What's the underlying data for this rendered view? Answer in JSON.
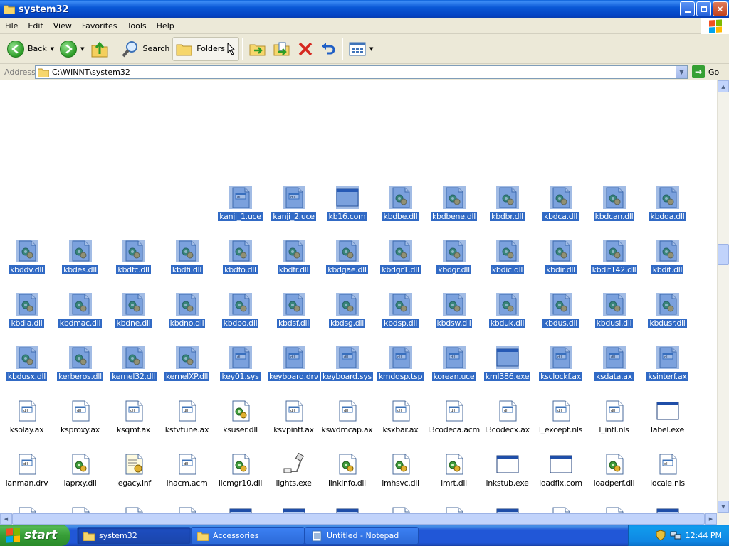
{
  "window": {
    "title": "system32"
  },
  "menu": {
    "items": [
      "File",
      "Edit",
      "View",
      "Favorites",
      "Tools",
      "Help"
    ]
  },
  "toolbar": {
    "back": "Back",
    "search": "Search",
    "folders": "Folders"
  },
  "address": {
    "label": "Address",
    "path": "C:\\WINNT\\system32",
    "go": "Go"
  },
  "files": [
    {
      "name": "kanji_1.uce",
      "type": "doc",
      "sel": true
    },
    {
      "name": "kanji_2.uce",
      "type": "doc",
      "sel": true
    },
    {
      "name": "kb16.com",
      "type": "exe",
      "sel": true
    },
    {
      "name": "kbdbe.dll",
      "type": "dll",
      "sel": true
    },
    {
      "name": "kbdbene.dll",
      "type": "dll",
      "sel": true
    },
    {
      "name": "kbdbr.dll",
      "type": "dll",
      "sel": true
    },
    {
      "name": "kbdca.dll",
      "type": "dll",
      "sel": true
    },
    {
      "name": "kbdcan.dll",
      "type": "dll",
      "sel": true
    },
    {
      "name": "kbdda.dll",
      "type": "dll",
      "sel": true
    },
    {
      "name": "kbddv.dll",
      "type": "dll",
      "sel": true
    },
    {
      "name": "kbdes.dll",
      "type": "dll",
      "sel": true
    },
    {
      "name": "kbdfc.dll",
      "type": "dll",
      "sel": true
    },
    {
      "name": "kbdfi.dll",
      "type": "dll",
      "sel": true
    },
    {
      "name": "kbdfo.dll",
      "type": "dll",
      "sel": true
    },
    {
      "name": "kbdfr.dll",
      "type": "dll",
      "sel": true
    },
    {
      "name": "kbdgae.dll",
      "type": "dll",
      "sel": true
    },
    {
      "name": "kbdgr1.dll",
      "type": "dll",
      "sel": true
    },
    {
      "name": "kbdgr.dll",
      "type": "dll",
      "sel": true
    },
    {
      "name": "kbdic.dll",
      "type": "dll",
      "sel": true
    },
    {
      "name": "kbdir.dll",
      "type": "dll",
      "sel": true
    },
    {
      "name": "kbdit142.dll",
      "type": "dll",
      "sel": true
    },
    {
      "name": "kbdit.dll",
      "type": "dll",
      "sel": true
    },
    {
      "name": "kbdla.dll",
      "type": "dll",
      "sel": true
    },
    {
      "name": "kbdmac.dll",
      "type": "dll",
      "sel": true
    },
    {
      "name": "kbdne.dll",
      "type": "dll",
      "sel": true
    },
    {
      "name": "kbdno.dll",
      "type": "dll",
      "sel": true
    },
    {
      "name": "kbdpo.dll",
      "type": "dll",
      "sel": true
    },
    {
      "name": "kbdsf.dll",
      "type": "dll",
      "sel": true
    },
    {
      "name": "kbdsg.dll",
      "type": "dll",
      "sel": true
    },
    {
      "name": "kbdsp.dll",
      "type": "dll",
      "sel": true
    },
    {
      "name": "kbdsw.dll",
      "type": "dll",
      "sel": true
    },
    {
      "name": "kbduk.dll",
      "type": "dll",
      "sel": true
    },
    {
      "name": "kbdus.dll",
      "type": "dll",
      "sel": true
    },
    {
      "name": "kbdusl.dll",
      "type": "dll",
      "sel": true
    },
    {
      "name": "kbdusr.dll",
      "type": "dll",
      "sel": true
    },
    {
      "name": "kbdusx.dll",
      "type": "dll",
      "sel": true
    },
    {
      "name": "kerberos.dll",
      "type": "dll",
      "sel": true
    },
    {
      "name": "kernel32.dll",
      "type": "dll",
      "sel": true
    },
    {
      "name": "kernelXP.dll",
      "type": "dll",
      "sel": true
    },
    {
      "name": "key01.sys",
      "type": "doc",
      "sel": true
    },
    {
      "name": "keyboard.drv",
      "type": "doc",
      "sel": true
    },
    {
      "name": "keyboard.sys",
      "type": "doc",
      "sel": true
    },
    {
      "name": "kmddsp.tsp",
      "type": "doc",
      "sel": true
    },
    {
      "name": "korean.uce",
      "type": "doc",
      "sel": true
    },
    {
      "name": "krnl386.exe",
      "type": "exe",
      "sel": true
    },
    {
      "name": "ksclockf.ax",
      "type": "doc",
      "sel": true
    },
    {
      "name": "ksdata.ax",
      "type": "doc",
      "sel": true
    },
    {
      "name": "ksinterf.ax",
      "type": "doc",
      "sel": true
    },
    {
      "name": "ksolay.ax",
      "type": "ax",
      "sel": false
    },
    {
      "name": "ksproxy.ax",
      "type": "ax",
      "sel": false
    },
    {
      "name": "ksqmf.ax",
      "type": "ax",
      "sel": false
    },
    {
      "name": "kstvtune.ax",
      "type": "ax",
      "sel": false
    },
    {
      "name": "ksuser.dll",
      "type": "dllw",
      "sel": false
    },
    {
      "name": "ksvpintf.ax",
      "type": "ax",
      "sel": false
    },
    {
      "name": "kswdmcap.ax",
      "type": "ax",
      "sel": false
    },
    {
      "name": "ksxbar.ax",
      "type": "ax",
      "sel": false
    },
    {
      "name": "l3codeca.acm",
      "type": "ax",
      "sel": false
    },
    {
      "name": "l3codecx.ax",
      "type": "ax",
      "sel": false
    },
    {
      "name": "l_except.nls",
      "type": "ax",
      "sel": false
    },
    {
      "name": "l_intl.nls",
      "type": "ax",
      "sel": false
    },
    {
      "name": "label.exe",
      "type": "exew",
      "sel": false
    },
    {
      "name": "lanman.drv",
      "type": "ax",
      "sel": false
    },
    {
      "name": "laprxy.dll",
      "type": "dllw",
      "sel": false
    },
    {
      "name": "legacy.inf",
      "type": "inf",
      "sel": false
    },
    {
      "name": "lhacm.acm",
      "type": "ax",
      "sel": false
    },
    {
      "name": "licmgr10.dll",
      "type": "dllw",
      "sel": false
    },
    {
      "name": "lights.exe",
      "type": "lights",
      "sel": false
    },
    {
      "name": "linkinfo.dll",
      "type": "dllw",
      "sel": false
    },
    {
      "name": "lmhsvc.dll",
      "type": "dllw",
      "sel": false
    },
    {
      "name": "lmrt.dll",
      "type": "dllw",
      "sel": false
    },
    {
      "name": "lnkstub.exe",
      "type": "exew",
      "sel": false
    },
    {
      "name": "loadfix.com",
      "type": "exew",
      "sel": false
    },
    {
      "name": "loadperf.dll",
      "type": "dllw",
      "sel": false
    },
    {
      "name": "locale.nls",
      "type": "ax",
      "sel": false
    }
  ],
  "taskbar": {
    "start": "start",
    "tasks": [
      {
        "label": "system32",
        "active": true
      },
      {
        "label": "Accessories",
        "active": false
      },
      {
        "label": "Untitled - Notepad",
        "active": false
      }
    ],
    "clock": "12:44 PM"
  }
}
